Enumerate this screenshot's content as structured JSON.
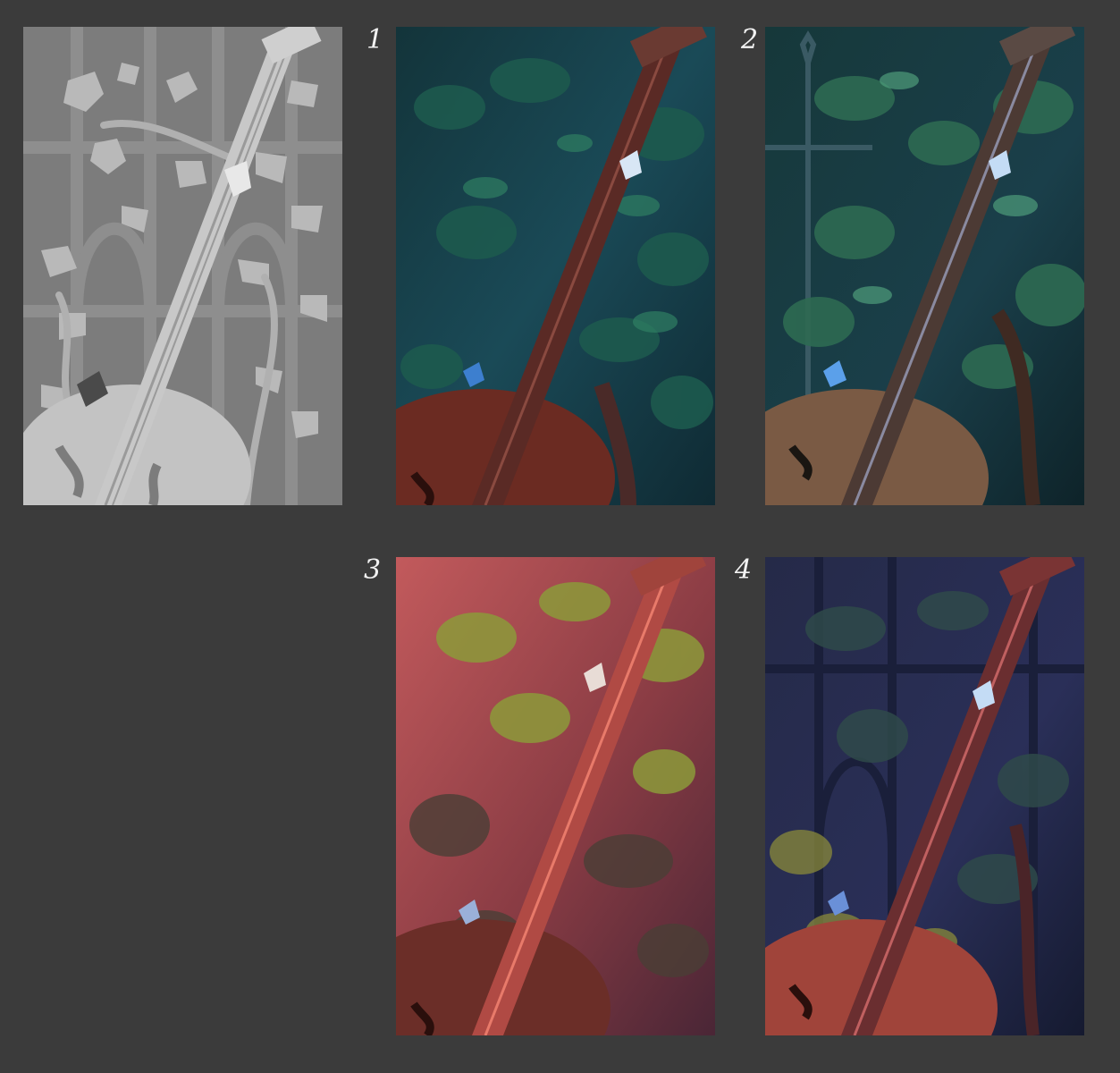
{
  "panels": [
    {
      "number": "",
      "variant": "grayscale value study"
    },
    {
      "number": "1",
      "variant": "teal night"
    },
    {
      "number": "2",
      "variant": "blue-green moonlight"
    },
    {
      "number": "3",
      "variant": "pink sunset"
    },
    {
      "number": "4",
      "variant": "indigo dusk"
    }
  ],
  "colors": {
    "canvas_bg": "#3b3b3b",
    "label": "#f2f2f2"
  }
}
